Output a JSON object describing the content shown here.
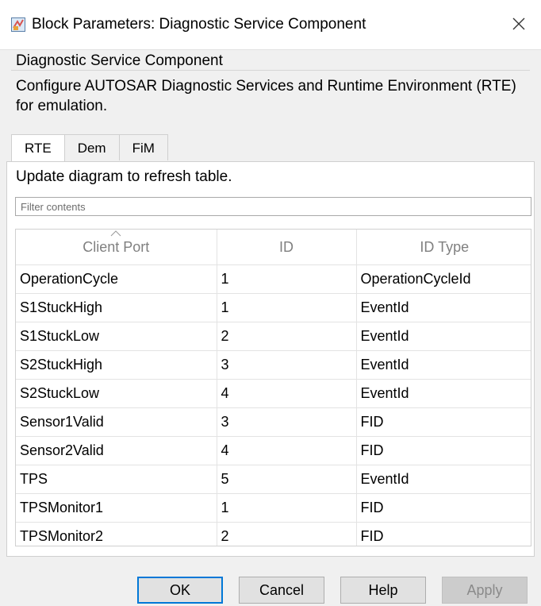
{
  "window": {
    "title": "Block Parameters: Diagnostic Service Component",
    "icon": "simulink-block-icon",
    "close_icon": "close-icon"
  },
  "group": {
    "title": "Diagnostic Service Component",
    "description": "Configure AUTOSAR Diagnostic Services and Runtime Environment (RTE) for emulation."
  },
  "tabs": [
    {
      "label": "RTE",
      "active": true
    },
    {
      "label": "Dem",
      "active": false
    },
    {
      "label": "FiM",
      "active": false
    }
  ],
  "panel": {
    "hint": "Update diagram to refresh table.",
    "filter_placeholder": "Filter contents",
    "filter_value": ""
  },
  "table": {
    "columns": [
      "Client Port",
      "ID",
      "ID Type"
    ],
    "sorted_column": "Client Port",
    "rows": [
      {
        "port": "OperationCycle",
        "id": "1",
        "type": "OperationCycleId"
      },
      {
        "port": "S1StuckHigh",
        "id": "1",
        "type": "EventId"
      },
      {
        "port": "S1StuckLow",
        "id": "2",
        "type": "EventId"
      },
      {
        "port": "S2StuckHigh",
        "id": "3",
        "type": "EventId"
      },
      {
        "port": "S2StuckLow",
        "id": "4",
        "type": "EventId"
      },
      {
        "port": "Sensor1Valid",
        "id": "3",
        "type": "FID"
      },
      {
        "port": "Sensor2Valid",
        "id": "4",
        "type": "FID"
      },
      {
        "port": "TPS",
        "id": "5",
        "type": "EventId"
      },
      {
        "port": "TPSMonitor1",
        "id": "1",
        "type": "FID"
      },
      {
        "port": "TPSMonitor2",
        "id": "2",
        "type": "FID"
      }
    ]
  },
  "buttons": {
    "ok": "OK",
    "cancel": "Cancel",
    "help": "Help",
    "apply": "Apply",
    "apply_enabled": false
  },
  "colors": {
    "accent": "#0078d7",
    "background": "#f0f0f0"
  }
}
